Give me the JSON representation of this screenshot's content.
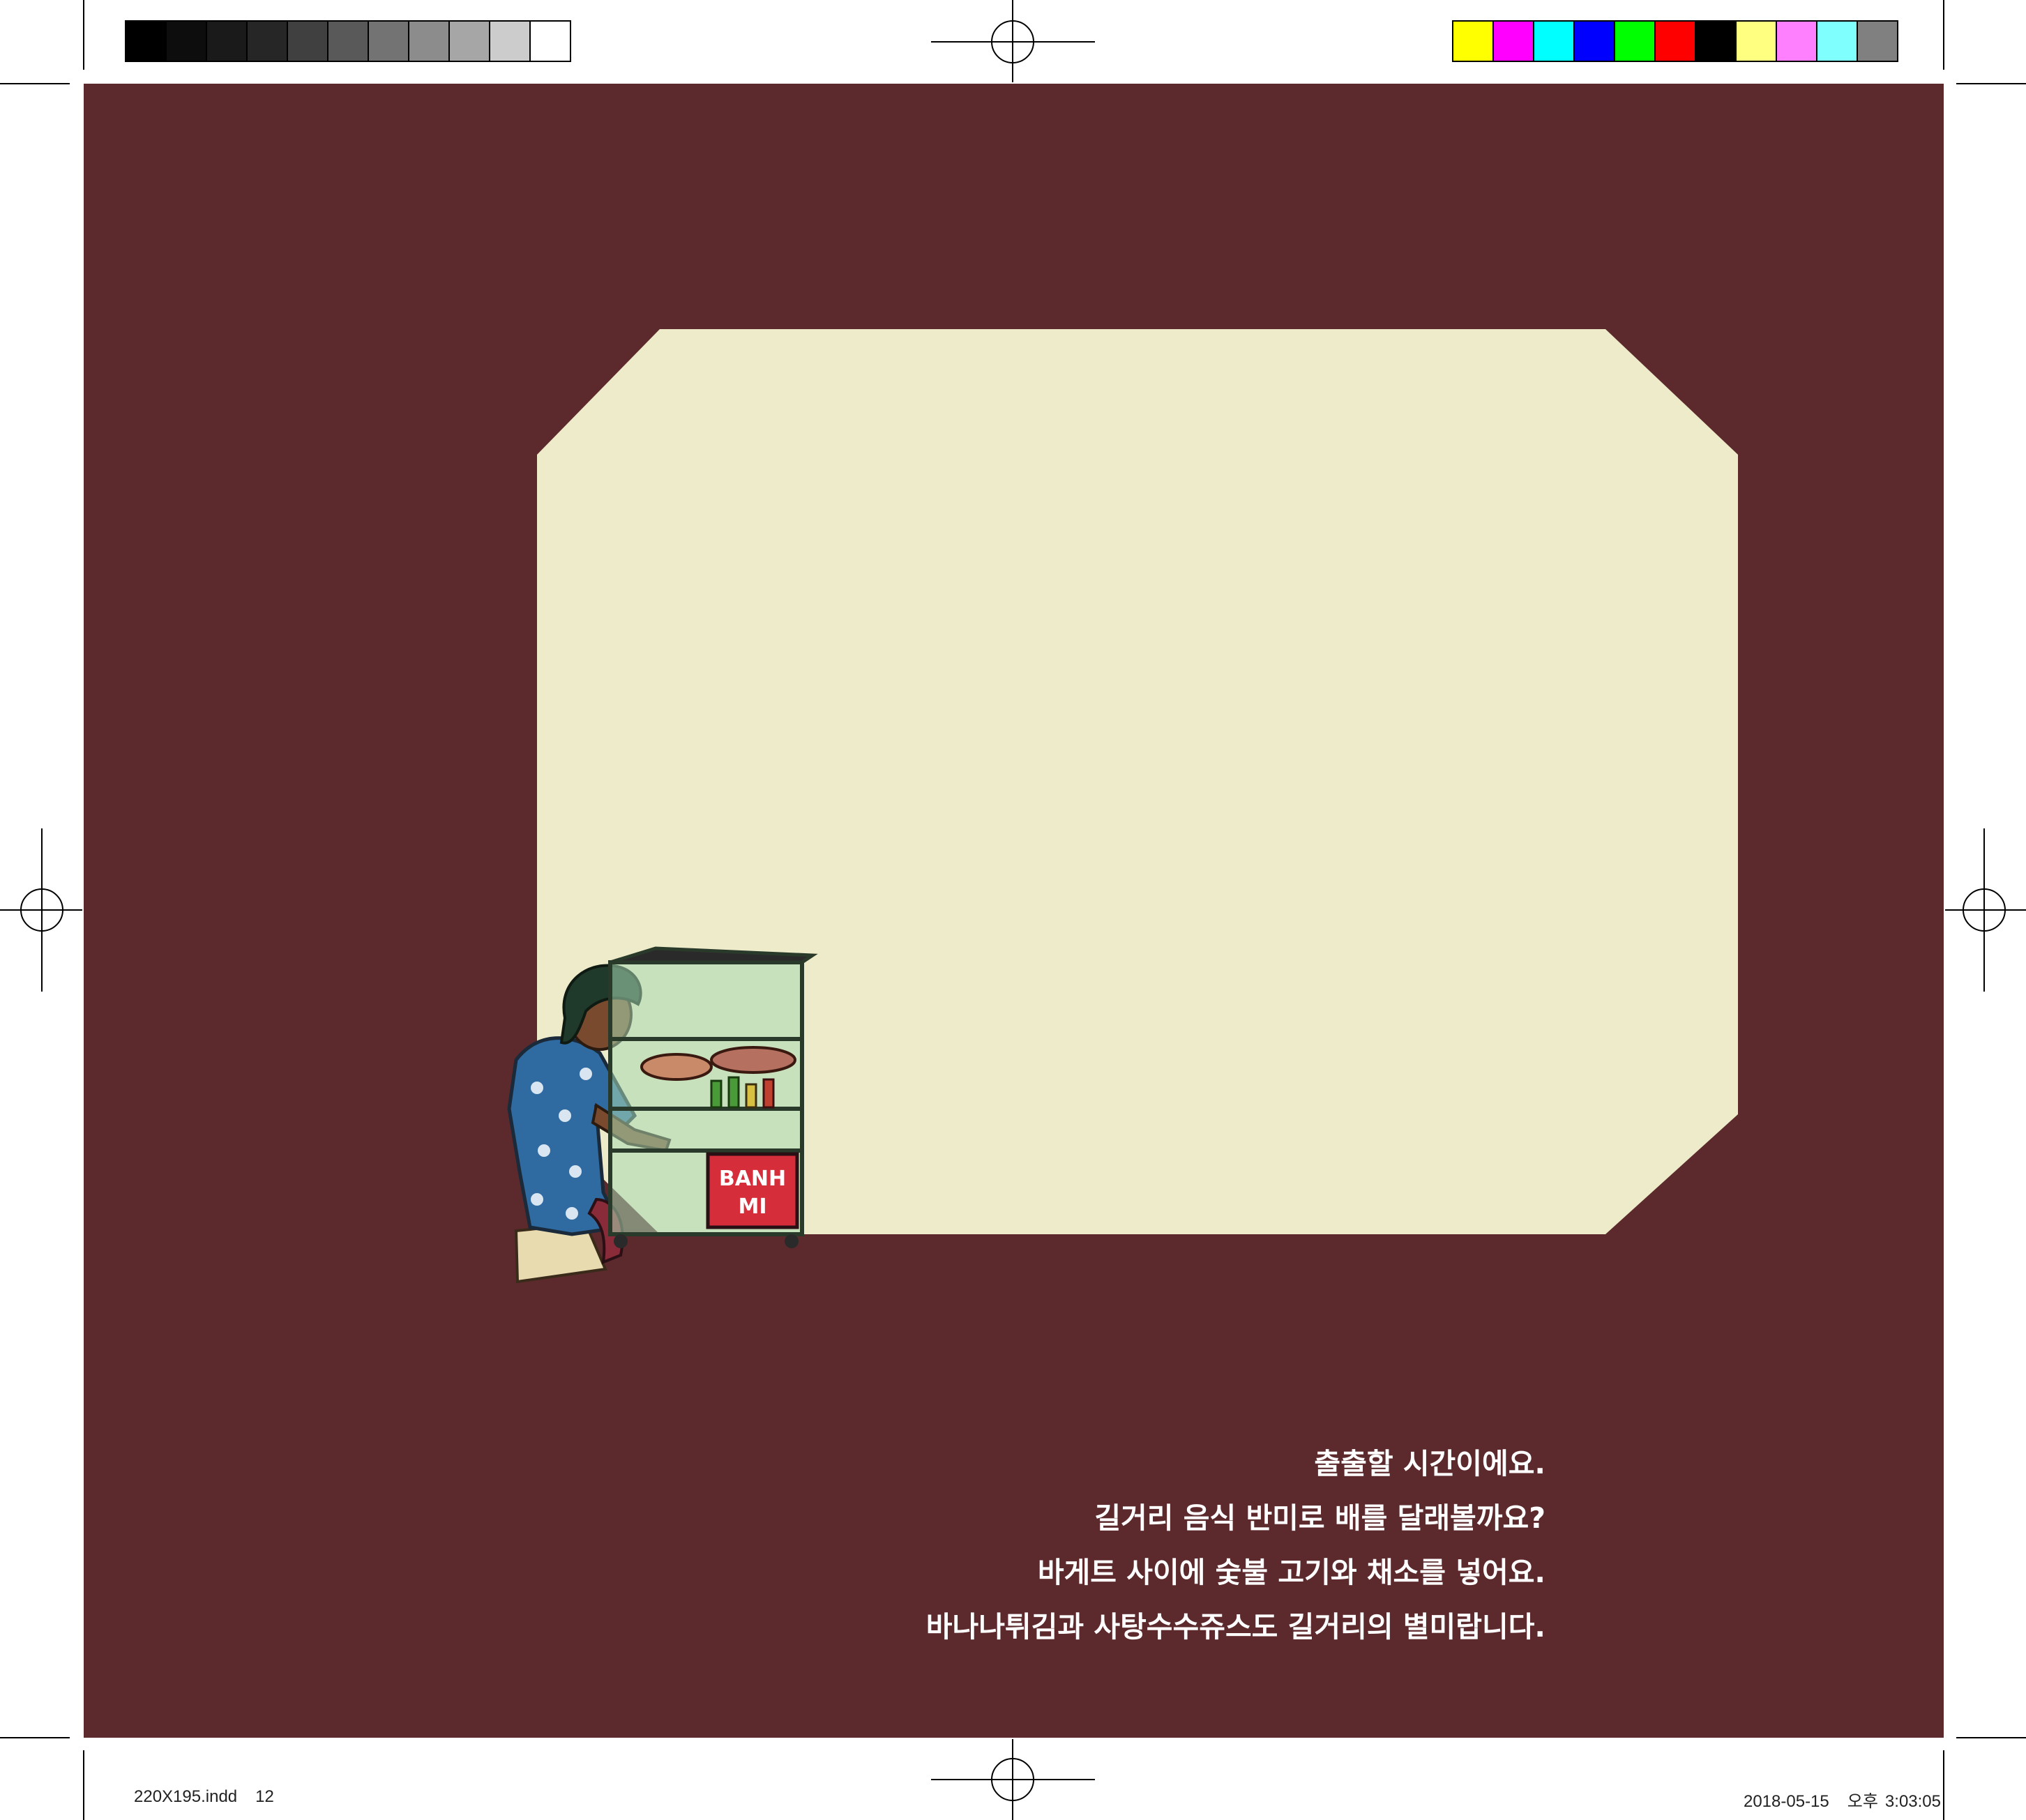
{
  "story": {
    "lines": [
      "출출할 시간이에요.",
      "길거리 음식 반미로 배를 달래볼까요?",
      "바게트 사이에 숯불 고기와 채소를 넣어요.",
      "바나나튀김과 사탕수수쥬스도 길거리의 별미랍니다."
    ]
  },
  "illustration": {
    "cart_sign_line1": "BANH",
    "cart_sign_line2": "MI",
    "cart_icon": "banh-mi-cart-icon",
    "vendor_icon": "street-vendor-woman-icon"
  },
  "slug": {
    "file": "220X195.indd",
    "page": "12",
    "date": "2018-05-15",
    "ampm": "오후",
    "time": "3:03:05"
  },
  "colors": {
    "page_background": "#5c2a2d",
    "panel": "#edebc9",
    "text": "#ffffff",
    "grayscale_bar": [
      "#000000",
      "#0d0d0d",
      "#1a1a1a",
      "#262626",
      "#404040",
      "#595959",
      "#737373",
      "#8c8c8c",
      "#a6a6a6",
      "#cccccc",
      "#ffffff"
    ],
    "color_bar": [
      "#ffff00",
      "#ff00ff",
      "#00ffff",
      "#0000ff",
      "#00ff00",
      "#ff0000",
      "#000000",
      "#ffff80",
      "#ff80ff",
      "#80ffff",
      "#808080"
    ]
  }
}
